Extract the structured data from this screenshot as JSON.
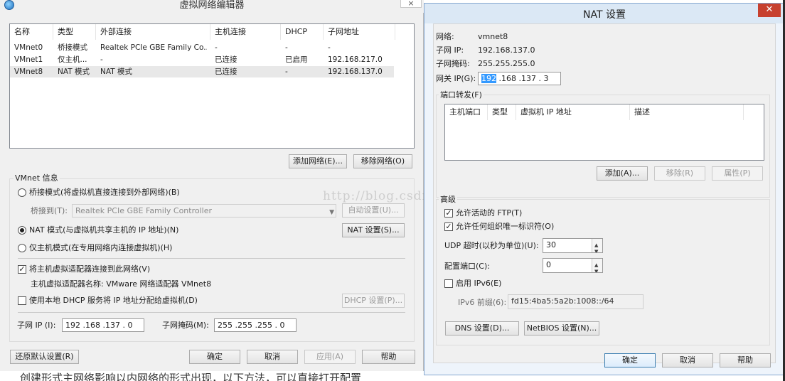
{
  "left": {
    "title": "虚拟网络编辑器",
    "close": "×",
    "columns": [
      "名称",
      "类型",
      "外部连接",
      "主机连接",
      "DHCP",
      "子网地址"
    ],
    "rows": [
      [
        "VMnet0",
        "桥接模式",
        "Realtek PCIe GBE Family Co...",
        "-",
        "-",
        "-"
      ],
      [
        "VMnet1",
        "仅主机...",
        "-",
        "已连接",
        "已启用",
        "192.168.217.0"
      ],
      [
        "VMnet8",
        "NAT 模式",
        "NAT 模式",
        "已连接",
        "-",
        "192.168.137.0"
      ]
    ],
    "add_network": "添加网络(E)...",
    "remove_network": "移除网络(O)",
    "info_group": "VMnet 信息",
    "bridge_mode": "桥接模式(将虚拟机直接连接到外部网络)(B)",
    "bridge_to_label": "桥接到(T):",
    "bridge_to_value": "Realtek PCIe GBE Family Controller",
    "auto_settings": "自动设置(U)...",
    "nat_mode": "NAT 模式(与虚拟机共享主机的 IP 地址)(N)",
    "nat_settings": "NAT 设置(S)...",
    "host_only": "仅主机模式(在专用网络内连接虚拟机)(H)",
    "connect_adapter": "将主机虚拟适配器连接到此网络(V)",
    "adapter_name": "主机虚拟适配器名称: VMware 网络适配器 VMnet8",
    "use_dhcp": "使用本地 DHCP 服务将 IP 地址分配给虚拟机(D)",
    "dhcp_settings": "DHCP 设置(P)...",
    "subnet_ip_label": "子网 IP (I):",
    "subnet_ip": "192 .168 .137 .  0",
    "subnet_mask_label": "子网掩码(M):",
    "subnet_mask": "255 .255 .255 .  0",
    "restore_defaults": "还原默认设置(R)",
    "ok": "确定",
    "cancel": "取消",
    "apply": "应用(A)",
    "help": "帮助"
  },
  "right": {
    "title": "NAT 设置",
    "close": "✕",
    "network_label": "网络:",
    "network_value": "vmnet8",
    "subnet_ip_label": "子网 IP:",
    "subnet_ip_value": "192.168.137.0",
    "subnet_mask_label": "子网掩码:",
    "subnet_mask_value": "255.255.255.0",
    "gateway_label": "网关 IP(G):",
    "gateway_first": "192",
    "gateway_rest": " .168 .137 .  3",
    "port_forward_group": "端口转发(F)",
    "pf_columns": [
      "主机端口",
      "类型",
      "虚拟机 IP 地址",
      "描述"
    ],
    "add": "添加(A)...",
    "remove": "移除(R)",
    "properties": "属性(P)",
    "advanced_group": "高级",
    "allow_ftp": "允许活动的 FTP(T)",
    "allow_oui": "允许任何组织唯一标识符(O)",
    "udp_timeout_label": "UDP 超时(以秒为单位)(U):",
    "udp_timeout": "30",
    "config_port_label": "配置端口(C):",
    "config_port": "0",
    "enable_ipv6": "启用 IPv6(E)",
    "ipv6_prefix_label": "IPv6 前缀(6):",
    "ipv6_prefix": "fd15:4ba5:5a2b:1008::/64",
    "dns_settings": "DNS 设置(D)...",
    "netbios_settings": "NetBIOS 设置(N)...",
    "ok": "确定",
    "cancel": "取消",
    "help": "帮助"
  },
  "watermark": "http://blog.csdn.net/",
  "bottom_text": "创建形式主网络影响以内网络的形式出现，以下方法，可以直接打开配置"
}
